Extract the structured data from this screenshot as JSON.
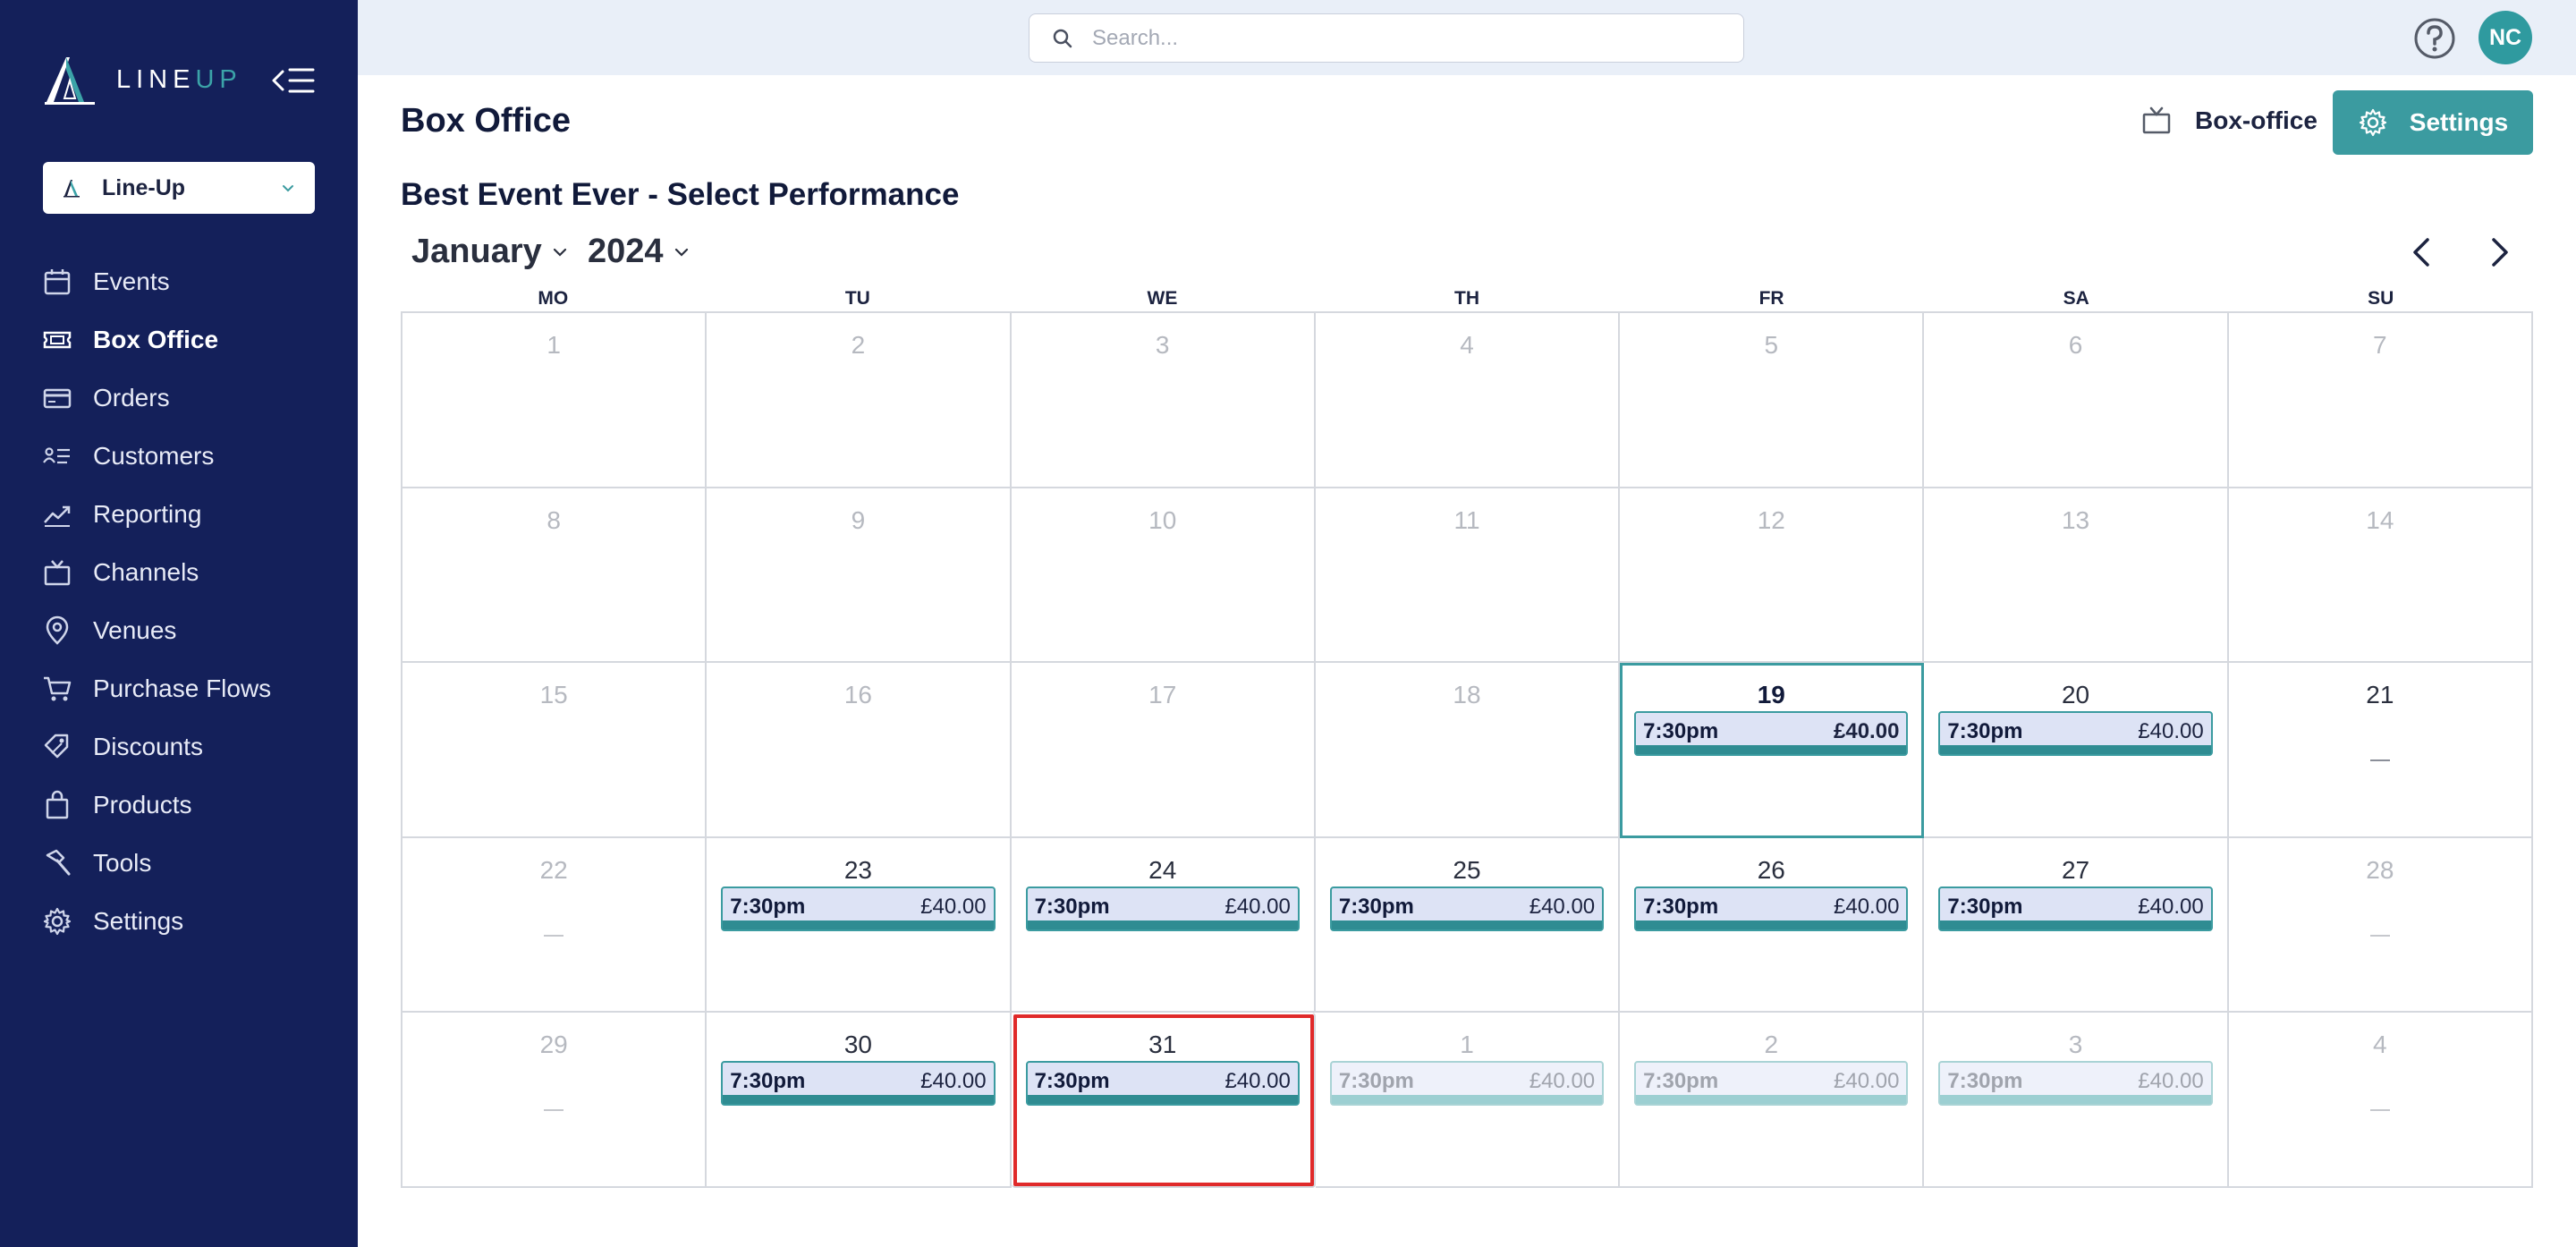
{
  "sidebar": {
    "brand_line": "LINE",
    "brand_up": "UP",
    "org_name": "Line-Up",
    "items": [
      {
        "label": "Events",
        "icon": "calendar-icon",
        "active": false
      },
      {
        "label": "Box Office",
        "icon": "ticket-icon",
        "active": true
      },
      {
        "label": "Orders",
        "icon": "credit-card-icon",
        "active": false
      },
      {
        "label": "Customers",
        "icon": "customers-icon",
        "active": false
      },
      {
        "label": "Reporting",
        "icon": "trend-chart-icon",
        "active": false
      },
      {
        "label": "Channels",
        "icon": "tv-icon",
        "active": false
      },
      {
        "label": "Venues",
        "icon": "map-pin-icon",
        "active": false
      },
      {
        "label": "Purchase Flows",
        "icon": "cart-icon",
        "active": false
      },
      {
        "label": "Discounts",
        "icon": "tags-icon",
        "active": false
      },
      {
        "label": "Products",
        "icon": "shopping-bag-icon",
        "active": false
      },
      {
        "label": "Tools",
        "icon": "hammer-icon",
        "active": false
      },
      {
        "label": "Settings",
        "icon": "gear-icon",
        "active": false
      }
    ]
  },
  "topbar": {
    "search_placeholder": "Search...",
    "avatar_initials": "NC"
  },
  "header": {
    "page_title": "Box Office",
    "channel_label": "Box-office",
    "settings_label": "Settings"
  },
  "calendar": {
    "title": "Best Event Ever - Select Performance",
    "month": "January",
    "year": "2024",
    "days_of_week": [
      "MO",
      "TU",
      "WE",
      "TH",
      "FR",
      "SA",
      "SU"
    ],
    "cells": [
      {
        "day": "1",
        "muted": true
      },
      {
        "day": "2",
        "muted": true
      },
      {
        "day": "3",
        "muted": true
      },
      {
        "day": "4",
        "muted": true
      },
      {
        "day": "5",
        "muted": true
      },
      {
        "day": "6",
        "muted": true
      },
      {
        "day": "7",
        "muted": true
      },
      {
        "day": "8",
        "muted": true
      },
      {
        "day": "9",
        "muted": true
      },
      {
        "day": "10",
        "muted": true
      },
      {
        "day": "11",
        "muted": true
      },
      {
        "day": "12",
        "muted": true
      },
      {
        "day": "13",
        "muted": true
      },
      {
        "day": "14",
        "muted": true
      },
      {
        "day": "15",
        "muted": true
      },
      {
        "day": "16",
        "muted": true
      },
      {
        "day": "17",
        "muted": true
      },
      {
        "day": "18",
        "muted": true
      },
      {
        "day": "19",
        "today": true,
        "perf": {
          "time": "7:30pm",
          "price": "£40.00"
        }
      },
      {
        "day": "20",
        "perf": {
          "time": "7:30pm",
          "price": "£40.00"
        }
      },
      {
        "day": "21",
        "dash": true
      },
      {
        "day": "22",
        "dash": true,
        "muted_num": true
      },
      {
        "day": "23",
        "perf": {
          "time": "7:30pm",
          "price": "£40.00"
        }
      },
      {
        "day": "24",
        "perf": {
          "time": "7:30pm",
          "price": "£40.00"
        }
      },
      {
        "day": "25",
        "perf": {
          "time": "7:30pm",
          "price": "£40.00"
        }
      },
      {
        "day": "26",
        "perf": {
          "time": "7:30pm",
          "price": "£40.00"
        }
      },
      {
        "day": "27",
        "perf": {
          "time": "7:30pm",
          "price": "£40.00"
        }
      },
      {
        "day": "28",
        "dash": true,
        "muted_num": true
      },
      {
        "day": "29",
        "dash": true,
        "muted_num": true
      },
      {
        "day": "30",
        "perf": {
          "time": "7:30pm",
          "price": "£40.00"
        }
      },
      {
        "day": "31",
        "selected": true,
        "perf": {
          "time": "7:30pm",
          "price": "£40.00"
        }
      },
      {
        "day": "1",
        "muted": true,
        "perf": {
          "time": "7:30pm",
          "price": "£40.00",
          "faded": true
        }
      },
      {
        "day": "2",
        "muted": true,
        "perf": {
          "time": "7:30pm",
          "price": "£40.00",
          "faded": true
        }
      },
      {
        "day": "3",
        "muted": true,
        "perf": {
          "time": "7:30pm",
          "price": "£40.00",
          "faded": true
        }
      },
      {
        "day": "4",
        "muted": true,
        "dash": true
      }
    ]
  },
  "colors": {
    "sidebar_bg": "#14205a",
    "accent": "#3b9ba0",
    "topbar_bg": "#e9eff8",
    "selected_outline": "#e02a2a"
  }
}
